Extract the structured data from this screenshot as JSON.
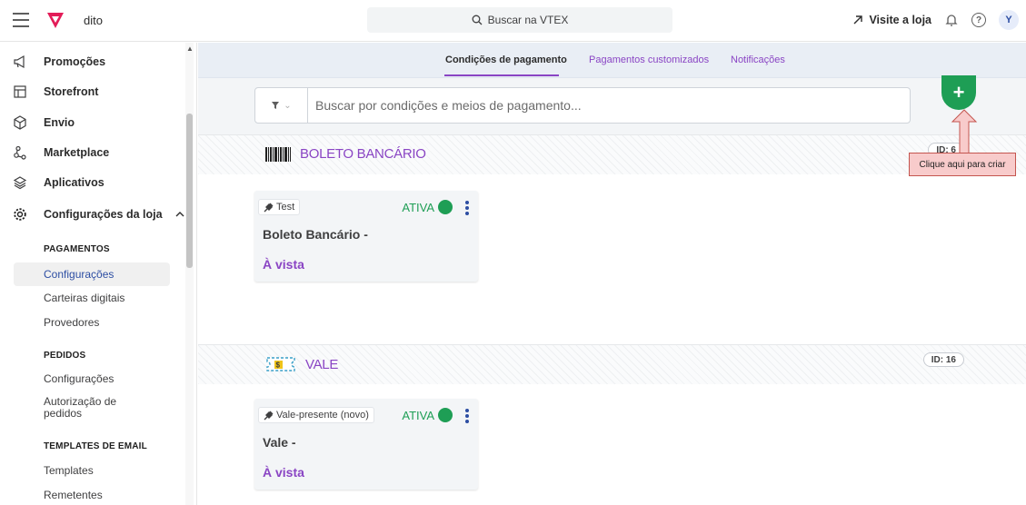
{
  "topbar": {
    "store_name": "dito",
    "search_placeholder": "Buscar na VTEX",
    "visit_label": "Visite a loja",
    "avatar_initial": "Y"
  },
  "sidebar": {
    "items": [
      {
        "label": "Promoções",
        "icon": "megaphone-icon"
      },
      {
        "label": "Storefront",
        "icon": "layout-icon"
      },
      {
        "label": "Envio",
        "icon": "box-icon"
      },
      {
        "label": "Marketplace",
        "icon": "share-icon"
      },
      {
        "label": "Aplicativos",
        "icon": "layers-icon"
      },
      {
        "label": "Configurações da loja",
        "icon": "gear-icon"
      }
    ],
    "groups": [
      {
        "title": "PAGAMENTOS",
        "items": [
          "Configurações",
          "Carteiras digitais",
          "Provedores"
        ]
      },
      {
        "title": "PEDIDOS",
        "items": [
          "Configurações",
          "Autorização de pedidos"
        ]
      },
      {
        "title": "TEMPLATES DE EMAIL",
        "items": [
          "Templates",
          "Remetentes"
        ]
      }
    ]
  },
  "tabs": [
    {
      "label": "Condições de pagamento",
      "active": true
    },
    {
      "label": "Pagamentos customizados",
      "active": false
    },
    {
      "label": "Notificações",
      "active": false
    }
  ],
  "filter": {
    "placeholder": "Buscar por condições e meios de pagamento...",
    "filter_icon": "funnel-icon"
  },
  "add_button": "+",
  "tooltip": "Clique aqui para criar",
  "sections": [
    {
      "title": "BOLETO BANCÁRIO",
      "id": "ID: 6",
      "card": {
        "tag": "Test",
        "status": "ATIVA",
        "name": "Boleto Bancário -",
        "condition": "À vista"
      }
    },
    {
      "title": "VALE",
      "id": "ID: 16",
      "card": {
        "tag": "Vale-presente (novo)",
        "status": "ATIVA",
        "name": "Vale -",
        "condition": "À vista"
      }
    }
  ],
  "colors": {
    "accent": "#8a45c4",
    "active_green": "#1e9e55",
    "link_blue": "#2d4ea3"
  }
}
